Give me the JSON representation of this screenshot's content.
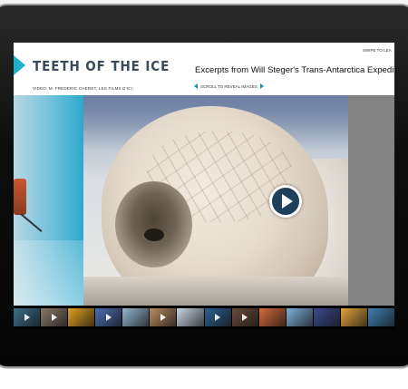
{
  "header": {
    "logo": "TEETH OF THE ICE",
    "credit": "VIDEO: M. FREDERIC CHERET, LES FILMS D'ICI",
    "subtitle": "Excerpts from Will Steger's Trans-Antarctica Expedition diary",
    "scroll_hint": "SCROLL TO REVEAL IMAGES",
    "swipe_hint": "SWIPE TO LEA"
  },
  "colors": {
    "accent": "#1bb3c9",
    "play_button": "#1f3f5a"
  },
  "player": {
    "play_icon": "play-icon"
  },
  "filmstrip": {
    "thumbnails": [
      {
        "color": "#3d6f8c",
        "play": true
      },
      {
        "color": "#8a7a66",
        "play": true
      },
      {
        "color": "#e0a020",
        "play": false
      },
      {
        "color": "#4a6fb0",
        "play": true
      },
      {
        "color": "#8fb6cf",
        "play": false
      },
      {
        "color": "#b98c62",
        "play": true
      },
      {
        "color": "#c9d6e2",
        "play": false
      },
      {
        "color": "#2e5f8f",
        "play": true
      },
      {
        "color": "#6a4a3a",
        "play": true
      },
      {
        "color": "#d46a3a",
        "play": false
      },
      {
        "color": "#7fb0d6",
        "play": false
      },
      {
        "color": "#3a4a8a",
        "play": false
      },
      {
        "color": "#e2a33a",
        "play": false
      },
      {
        "color": "#3f7fb0",
        "play": false
      }
    ]
  }
}
